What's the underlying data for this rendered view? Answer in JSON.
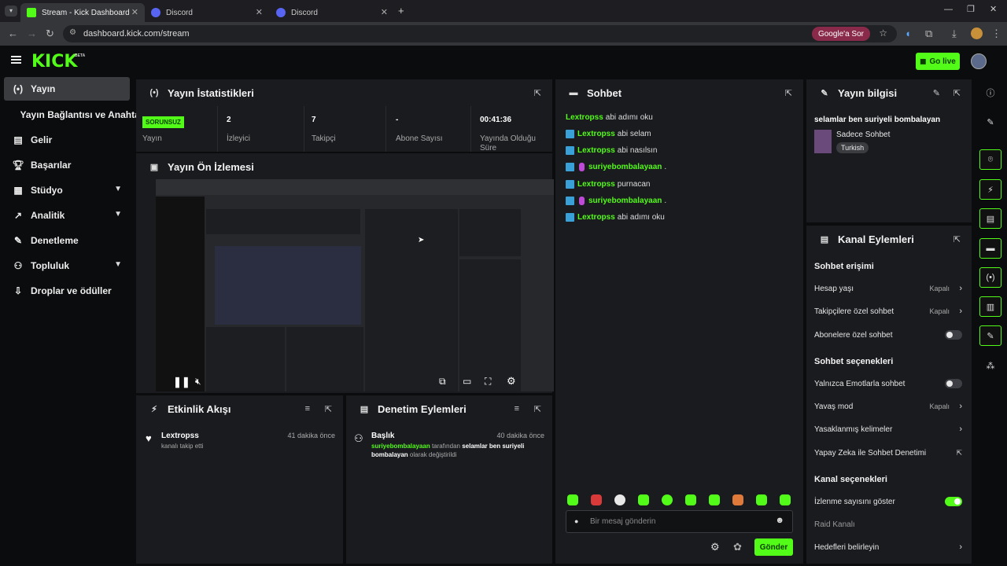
{
  "browser": {
    "tabs": [
      {
        "label": "Stream - Kick Dashboard",
        "active": true
      },
      {
        "label": "Discord",
        "active": false
      },
      {
        "label": "Discord",
        "active": false
      }
    ],
    "url": "dashboard.kick.com/stream",
    "google_btn": "Google'a Sor"
  },
  "header": {
    "logo": "KICK",
    "beta": "BETA",
    "go_live": "Go live"
  },
  "sidebar": {
    "items": [
      {
        "label": "Yayın",
        "icon": "broadcast-icon",
        "active": true
      },
      {
        "label": "Yayın Bağlantısı ve Anahtarı",
        "icon": "",
        "active": false
      },
      {
        "label": "Gelir",
        "icon": "revenue-icon"
      },
      {
        "label": "Başarılar",
        "icon": "trophy-icon"
      },
      {
        "label": "Stüdyo",
        "icon": "studio-icon",
        "chevron": true
      },
      {
        "label": "Analitik",
        "icon": "analytics-icon",
        "chevron": true
      },
      {
        "label": "Denetleme",
        "icon": "wrench-icon"
      },
      {
        "label": "Topluluk",
        "icon": "community-icon",
        "chevron": true
      },
      {
        "label": "Droplar ve ödüller",
        "icon": "drops-icon"
      }
    ]
  },
  "stats": {
    "title": "Yayın İstatistikleri",
    "status_badge": "SORUNSUZ",
    "cells": [
      {
        "value": "",
        "label": "Yayın"
      },
      {
        "value": "2",
        "label": "İzleyici"
      },
      {
        "value": "7",
        "label": "Takipçi"
      },
      {
        "value": "-",
        "label": "Abone Sayısı"
      },
      {
        "value": "00:41:36",
        "label": "Yayında Olduğu Süre"
      }
    ]
  },
  "preview": {
    "title": "Yayın Ön İzlemesi"
  },
  "activity": {
    "title": "Etkinlik Akışı",
    "items": [
      {
        "user": "Lextropss",
        "text": "kanalı takip etti",
        "time": "41 dakika önce"
      }
    ]
  },
  "moderation": {
    "title": "Denetim Eylemleri",
    "items": [
      {
        "title": "Başlık",
        "time": "40 dakika önce",
        "user": "suriyebombalayaan",
        "text1": "tarafından",
        "text2": "selamlar ben suriyeli bombalayan",
        "text3": "olarak değiştirildi"
      }
    ]
  },
  "chat": {
    "title": "Sohbet",
    "messages": [
      {
        "user": "Lextropss",
        "text": "abi adımı oku",
        "badge": false,
        "mic": false
      },
      {
        "user": "Lextropss",
        "text": "abi selam",
        "badge": true,
        "mic": false
      },
      {
        "user": "Lextropss",
        "text": "abi nasılsın",
        "badge": true,
        "mic": false
      },
      {
        "user": "suriyebombalayaan",
        "text": ".",
        "badge": true,
        "mic": true
      },
      {
        "user": "Lextropss",
        "text": "purnacan",
        "badge": true,
        "mic": false
      },
      {
        "user": "suriyebombalayaan",
        "text": ".",
        "badge": true,
        "mic": true
      },
      {
        "user": "Lextropss",
        "text": "abi adımı oku",
        "badge": true,
        "mic": false
      }
    ],
    "input_placeholder": "Bir mesaj gönderin",
    "send": "Gönder"
  },
  "stream_info": {
    "title": "Yayın bilgisi",
    "stream_title": "selamlar ben suriyeli bombalayan",
    "category": "Sadece Sohbet",
    "tag": "Turkish"
  },
  "channel_actions": {
    "title": "Kanal Eylemleri",
    "section1": "Sohbet erişimi",
    "account_age": "Hesap yaşı",
    "account_age_val": "Kapalı",
    "followers_only": "Takipçilere özel sohbet",
    "followers_only_val": "Kapalı",
    "subs_only": "Abonelere özel sohbet",
    "section2": "Sohbet seçenekleri",
    "emotes_only": "Yalnızca Emotlarla sohbet",
    "slow_mode": "Yavaş mod",
    "slow_mode_val": "Kapalı",
    "banned_words": "Yasaklanmış kelimeler",
    "ai_moderation": "Yapay Zeka ile Sohbet Denetimi",
    "section3": "Kanal seçenekleri",
    "show_viewers": "İzlenme sayısını göster",
    "raid": "Raid Kanalı",
    "goals": "Hedefleri belirleyin"
  },
  "colors": {
    "accent": "#53fc18",
    "panel": "#191b1f",
    "bg": "#0b0c0d"
  }
}
